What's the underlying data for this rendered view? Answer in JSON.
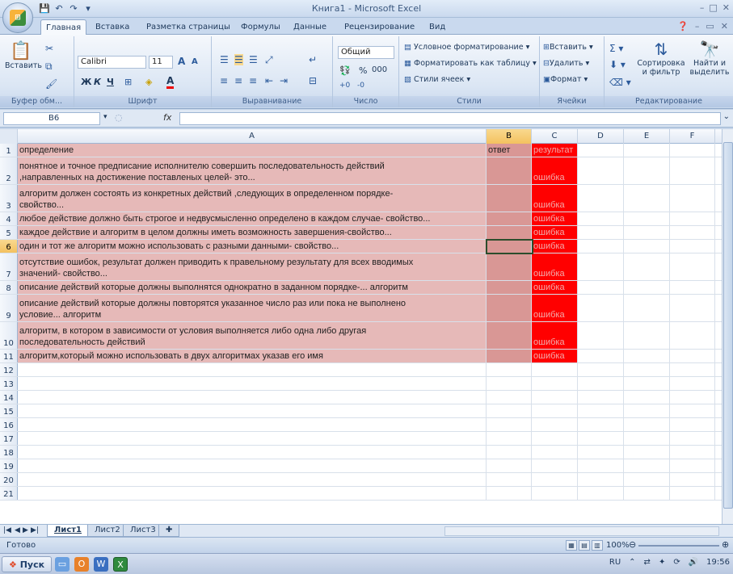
{
  "window": {
    "title": "Книга1 - Microsoft Excel"
  },
  "tabs": [
    "Главная",
    "Вставка",
    "Разметка страницы",
    "Формулы",
    "Данные",
    "Рецензирование",
    "Вид"
  ],
  "ribbon": {
    "clipboard": {
      "label": "Буфер обм...",
      "paste": "Вставить"
    },
    "font": {
      "label": "Шрифт",
      "name": "Calibri",
      "size": "11",
      "bold": "Ж",
      "italic": "К",
      "underline": "Ч"
    },
    "alignment": {
      "label": "Выравнивание"
    },
    "number": {
      "label": "Число",
      "format": "Общий",
      "percent": "%",
      "thousands": "000"
    },
    "styles": {
      "label": "Стили",
      "conditional": "Условное форматирование",
      "as_table": "Форматировать как таблицу",
      "cell_styles": "Стили ячеек"
    },
    "cells": {
      "label": "Ячейки",
      "insert": "Вставить",
      "delete": "Удалить",
      "format": "Формат"
    },
    "editing": {
      "label": "Редактирование",
      "sort": "Сортировка\nи фильтр",
      "sort1": "Сортировка",
      "sort2": "и фильтр",
      "find1": "Найти и",
      "find2": "выделить"
    }
  },
  "formula_bar": {
    "name_box": "B6",
    "fx": "fx",
    "value": ""
  },
  "columns": [
    "A",
    "B",
    "C",
    "D",
    "E",
    "F"
  ],
  "rows": [
    {
      "n": "1",
      "a": [
        "определение"
      ],
      "b": "ответ",
      "c": "результат"
    },
    {
      "n": "2",
      "a": [
        "понятное и точное предписание исполнителю совершить последовательность действий",
        ",направленных на достижение поставленых целей- это..."
      ],
      "b": "",
      "c": "ошибка"
    },
    {
      "n": "3",
      "a": [
        "алгоритм должен состоять из конкретных действий ,следующих в определенном порядке-",
        "свойство..."
      ],
      "b": "",
      "c": "ошибка"
    },
    {
      "n": "4",
      "a": [
        "любое действие должно быть строгое и недвусмысленно определено в каждом случае- свойство..."
      ],
      "b": "",
      "c": "ошибка"
    },
    {
      "n": "5",
      "a": [
        "каждое действие и алгоритм в целом должны иметь возможность завершения-свойство..."
      ],
      "b": "",
      "c": "ошибка"
    },
    {
      "n": "6",
      "a": [
        "один и тот же алгоритм можно использовать с разными данными- свойство..."
      ],
      "b": "",
      "c": "ошибка"
    },
    {
      "n": "7",
      "a": [
        "отсутствие ошибок, результат должен приводить к правельному результату для всех вводимых",
        "значений- свойство..."
      ],
      "b": "",
      "c": "ошибка"
    },
    {
      "n": "8",
      "a": [
        "описание действий которые должны выполнятся однократно в заданном порядке-... алгоритм"
      ],
      "b": "",
      "c": "ошибка"
    },
    {
      "n": "9",
      "a": [
        "описание действий которые должны повторятся указанное число раз или пока не выполнено",
        "условие... алгоритм"
      ],
      "b": "",
      "c": "ошибка"
    },
    {
      "n": "10",
      "a": [
        "алгоритм, в котором в зависимости от условия выполняется либо одна либо другая",
        "последовательность действий"
      ],
      "b": "",
      "c": "ошибка"
    },
    {
      "n": "11",
      "a": [
        "алгоритм,который можно использовать в двух алгоритмах указав его имя"
      ],
      "b": "",
      "c": "ошибка"
    }
  ],
  "empty_rows": [
    "12",
    "13",
    "14",
    "15",
    "16",
    "17",
    "18",
    "19",
    "20",
    "21"
  ],
  "sheets": [
    "Лист1",
    "Лист2",
    "Лист3"
  ],
  "status": {
    "text": "Готово",
    "zoom": "100%"
  },
  "taskbar": {
    "start": "Пуск",
    "lang": "RU",
    "time": "19:56"
  }
}
